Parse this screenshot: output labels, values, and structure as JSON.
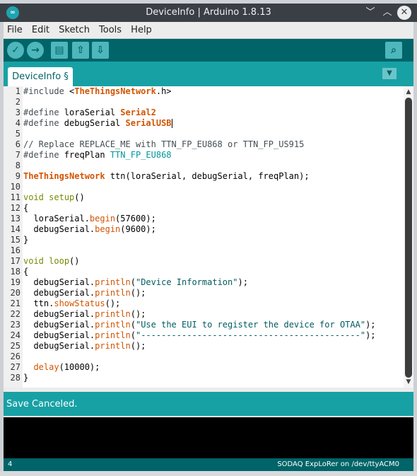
{
  "window": {
    "title": "DeviceInfo | Arduino 1.8.13",
    "app_icon": "∞",
    "minimize_icon": "chevron-down-icon",
    "maximize_icon": "chevron-up-icon",
    "close_icon": "close-icon"
  },
  "menu": [
    "File",
    "Edit",
    "Sketch",
    "Tools",
    "Help"
  ],
  "toolbar": {
    "verify_icon": "✓",
    "upload_icon": "→",
    "new_icon": "▤",
    "open_icon": "⇧",
    "save_icon": "⇩",
    "monitor_icon": "⌕"
  },
  "tabs": {
    "active_label": "DeviceInfo §",
    "menu_icon": "▼"
  },
  "editor": {
    "line_numbers": [
      "1",
      "2",
      "3",
      "4",
      "5",
      "6",
      "7",
      "8",
      "9",
      "10",
      "11",
      "12",
      "13",
      "14",
      "15",
      "16",
      "17",
      "18",
      "19",
      "20",
      "21",
      "22",
      "23",
      "24",
      "25",
      "26",
      "27",
      "28"
    ],
    "lines": [
      "#include <TheThingsNetwork.h>",
      "",
      "#define loraSerial Serial2",
      "#define debugSerial SerialUSB",
      "",
      "// Replace REPLACE_ME with TTN_FP_EU868 or TTN_FP_US915",
      "#define freqPlan TTN_FP_EU868",
      "",
      "TheThingsNetwork ttn(loraSerial, debugSerial, freqPlan);",
      "",
      "void setup()",
      "{",
      "  loraSerial.begin(57600);",
      "  debugSerial.begin(9600);",
      "}",
      "",
      "void loop()",
      "{",
      "  debugSerial.println(\"Device Information\");",
      "  debugSerial.println();",
      "  ttn.showStatus();",
      "  debugSerial.println();",
      "  debugSerial.println(\"Use the EUI to register the device for OTAA\");",
      "  debugSerial.println(\"-------------------------------------------\");",
      "  debugSerial.println();",
      "",
      "  delay(10000);",
      "}"
    ]
  },
  "status": {
    "message": "Save Canceled."
  },
  "footer": {
    "line": "4",
    "board": "SODAQ ExpLoRer on /dev/ttyACM0"
  },
  "colors": {
    "toolbar": "#006468",
    "tabbar": "#17a1a5",
    "titlebar": "#3a3f46",
    "console": "#000000"
  }
}
